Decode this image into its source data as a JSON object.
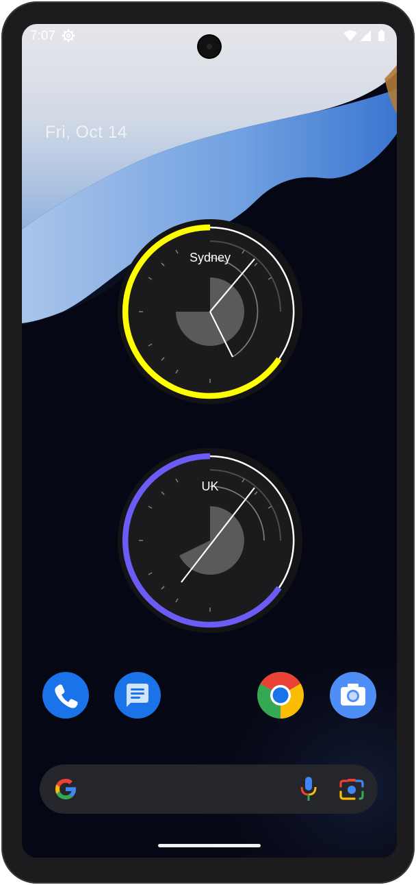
{
  "status_bar": {
    "time": "7:07"
  },
  "date_widget": {
    "text": "Fri, Oct 14"
  },
  "clocks": [
    {
      "city": "Sydney",
      "accent": "#ffff00"
    },
    {
      "city": "UK",
      "accent": "#6b5cf6"
    }
  ],
  "dock": {
    "apps": [
      {
        "name": "Phone",
        "icon": "phone-icon",
        "color": "#1a73e8"
      },
      {
        "name": "Messages",
        "icon": "messages-icon",
        "color": "#1a73e8"
      },
      {
        "name": "Chrome",
        "icon": "chrome-icon",
        "color": "#ea4335"
      },
      {
        "name": "Camera",
        "icon": "camera-icon",
        "color": "#4f8ef7"
      }
    ]
  },
  "search_bar": {
    "icons": [
      "google-g-icon",
      "microphone-icon",
      "lens-icon"
    ]
  }
}
